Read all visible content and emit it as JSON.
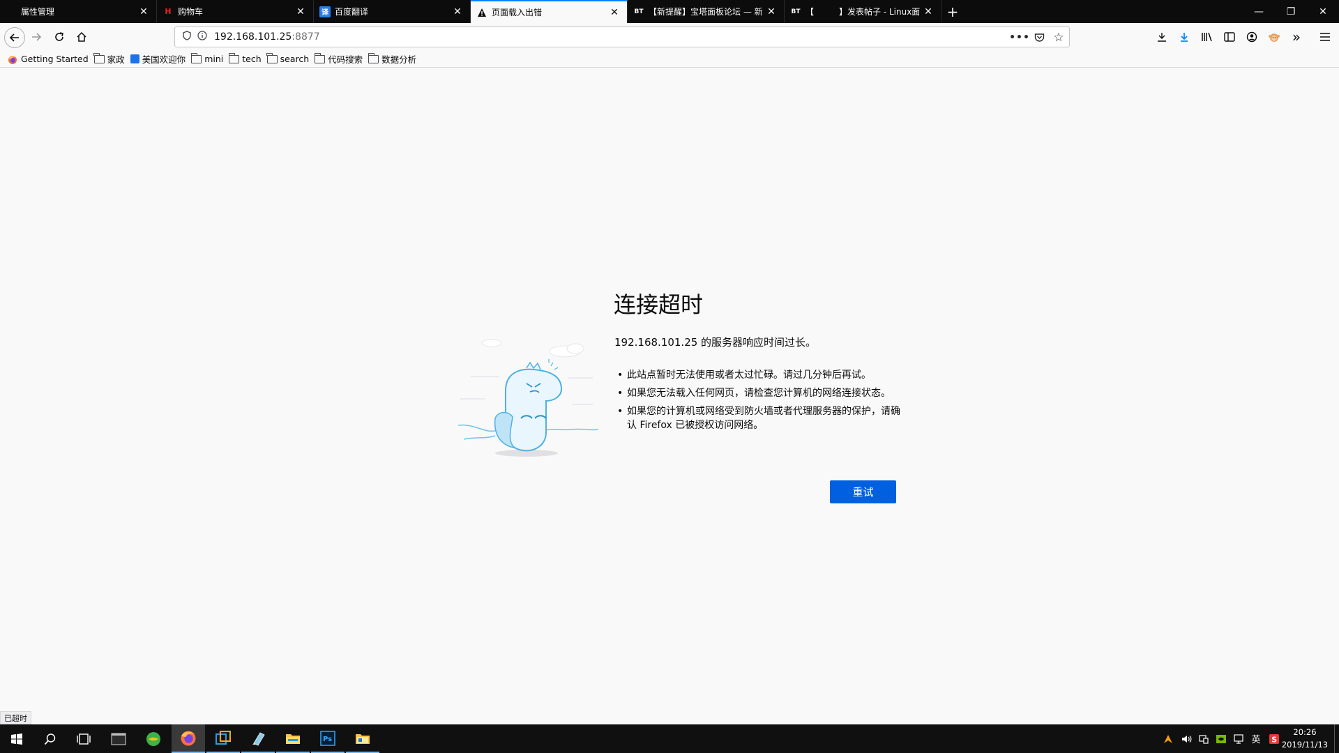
{
  "browser": {
    "tabs": [
      {
        "label": "属性管理",
        "icon": "page-icon",
        "active": false
      },
      {
        "label": "购物车",
        "icon": "h-logo-icon",
        "active": false
      },
      {
        "label": "百度翻译",
        "icon": "translate-icon",
        "active": false
      },
      {
        "label": "页面载入出错",
        "icon": "warning-icon",
        "active": true
      },
      {
        "label": "【新提醒】宝塔面板论坛 — 新",
        "icon": "bt-icon",
        "active": false
      },
      {
        "label": "【　　　】发表帖子 - Linux面",
        "icon": "bt-icon",
        "active": false
      }
    ],
    "tab_icon_text": {
      "bt": "BT",
      "translate": "译",
      "h": "H"
    },
    "address": {
      "host": "192.168.101.25",
      "port": ":8877"
    },
    "bookmarks": [
      {
        "label": "Getting Started",
        "icon": "firefox-icon"
      },
      {
        "label": "家政",
        "icon": "folder-icon"
      },
      {
        "label": "美国欢迎你",
        "icon": "site-icon"
      },
      {
        "label": "mini",
        "icon": "folder-icon"
      },
      {
        "label": "tech",
        "icon": "folder-icon"
      },
      {
        "label": "search",
        "icon": "folder-icon"
      },
      {
        "label": "代码搜索",
        "icon": "folder-icon"
      },
      {
        "label": "数据分析",
        "icon": "folder-icon"
      }
    ]
  },
  "error_page": {
    "title": "连接超时",
    "description": "192.168.101.25 的服务器响应时间过长。",
    "bullets": [
      "此站点暂时无法使用或者太过忙碌。请过几分钟后再试。",
      "如果您无法载入任何网页，请检查您计算机的网络连接状态。",
      "如果您的计算机或网络受到防火墙或者代理服务器的保护，请确认 Firefox 已被授权访问网络。"
    ],
    "retry_label": "重试"
  },
  "status_bar": {
    "text": "已超时"
  },
  "taskbar": {
    "tray_lang": "英",
    "time": "20:26",
    "date": "2019/11/13"
  },
  "colors": {
    "accent": "#0060df",
    "tab_highlight": "#0a84ff"
  }
}
